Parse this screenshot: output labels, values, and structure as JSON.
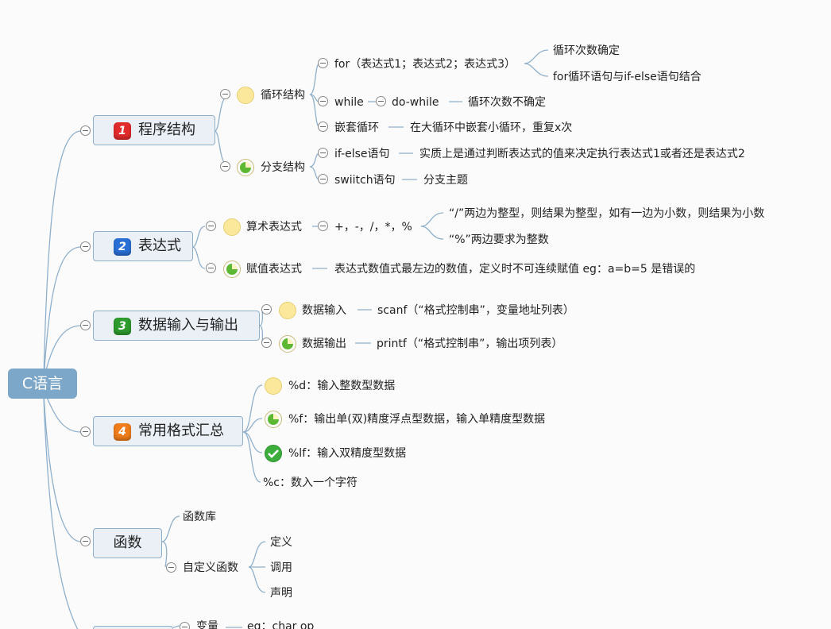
{
  "map": {
    "root": "C语言",
    "main": [
      {
        "num": "1",
        "label": "程序结构"
      },
      {
        "num": "2",
        "label": "表达式"
      },
      {
        "num": "3",
        "label": "数据输入与输出"
      },
      {
        "num": "4",
        "label": "常用格式汇总"
      },
      {
        "label": "函数"
      }
    ],
    "s1": {
      "loop": "循环结构",
      "branch": "分支结构",
      "for": "for（表达式1；表达式2；表达式3）",
      "for_a": "循环次数确定",
      "for_b": "for循环语句与if-else语句结合",
      "while": "while",
      "dowhile": "do-while",
      "while_note": "循环次数不确定",
      "nested": "嵌套循环",
      "nested_note": "在大循环中嵌套小循环，重复x次",
      "ifelse": "if-else语句",
      "ifelse_note": "实质上是通过判断表达式的值来决定执行表达式1或者还是表达式2",
      "switch": "swiitch语句",
      "switch_note": "分支主题"
    },
    "s2": {
      "arith": "算术表达式",
      "ops": "+，-，/，*，%",
      "ops_a": "“/”两边为整型，则结果为整型，如有一边为小数，则结果为小数",
      "ops_b": "“%”两边要求为整数",
      "assign": "赋值表达式",
      "assign_note": "表达式数值式最左边的数值，定义时不可连续赋值  eg：a=b=5 是错误的"
    },
    "s3": {
      "input": "数据输入",
      "input_note": "scanf（“格式控制串”，变量地址列表）",
      "output": "数据输出",
      "output_note": "printf（“格式控制串”，输出项列表）"
    },
    "s4": {
      "d": "%d：输入整数型数据",
      "f": "%f：输出单(双)精度浮点型数据，输入单精度型数据",
      "lf": "%lf：输入双精度型数据",
      "c": "%c：数入一个字符"
    },
    "s5": {
      "lib": "函数库",
      "custom": "自定义函数",
      "def": "定义",
      "call": "调用",
      "decl": "声明"
    },
    "s6": {
      "var": "变量",
      "var_note": "eg：char op"
    }
  },
  "colors": {
    "line": "#8fb0cc",
    "root": "#7da7c8",
    "badge1": "#e32b2b",
    "badge2": "#2a6fd6",
    "badge3": "#2e9b2e",
    "badge4": "#f07d1a"
  },
  "icons": {
    "priority": "priority-number-icon",
    "progress_start": "progress-empty-icon",
    "progress_quarter": "progress-pie-icon",
    "done": "checkmark-icon",
    "collapse": "collapse-toggle-icon"
  }
}
